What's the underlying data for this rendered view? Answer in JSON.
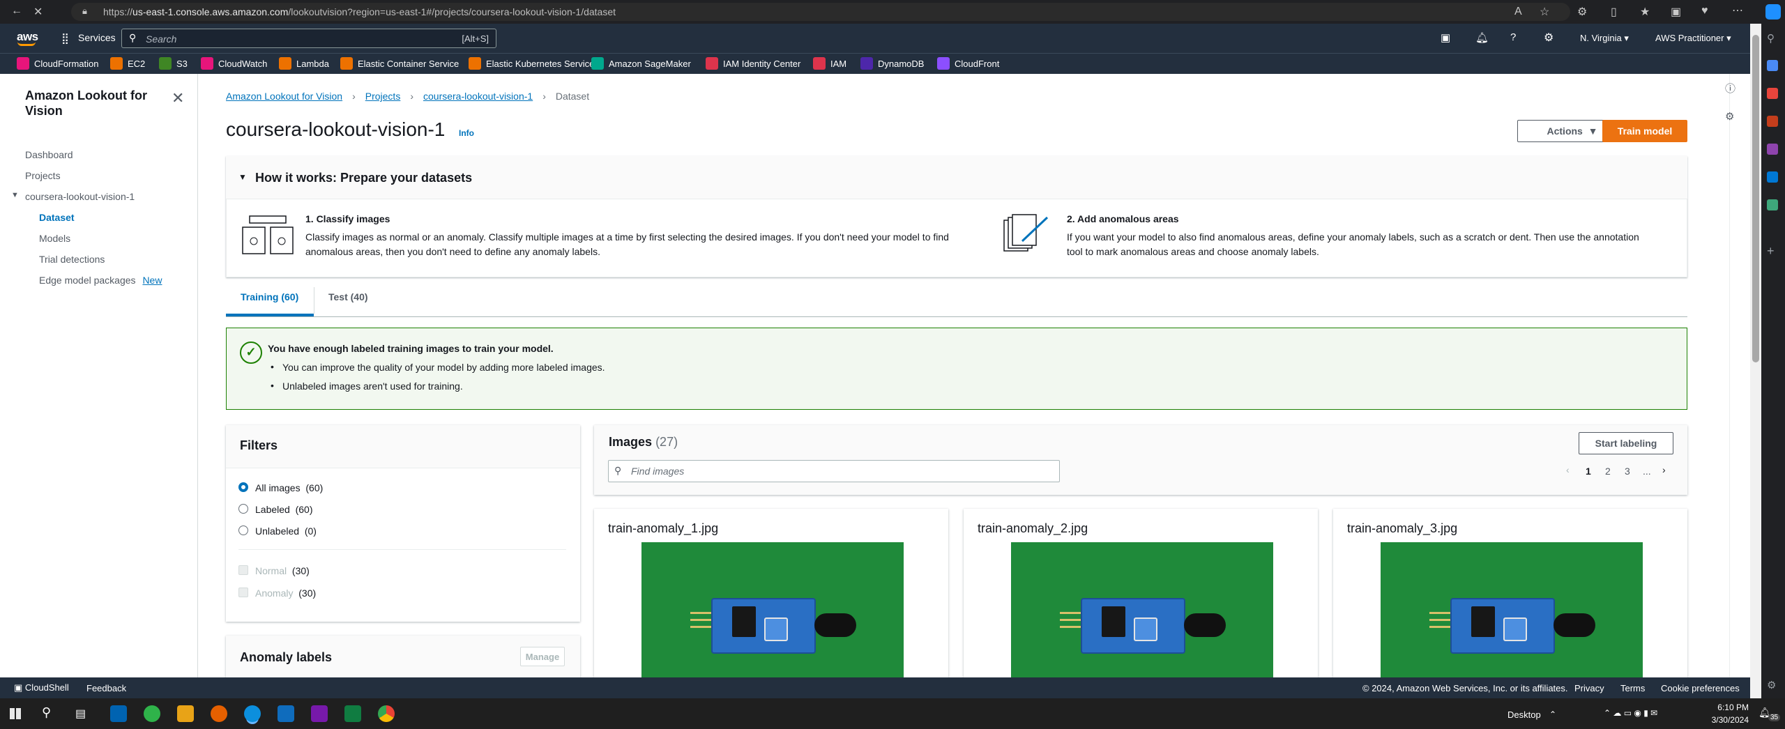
{
  "browser": {
    "url_prefix": "https://",
    "url_host": "us-east-1.console.aws.amazon.com",
    "url_path": "/lookoutvision?region=us-east-1#/projects/coursera-lookout-vision-1/dataset"
  },
  "aws_header": {
    "logo": "aws",
    "services_label": "Services",
    "search_placeholder": "Search",
    "search_shortcut": "[Alt+S]",
    "region": "N. Virginia",
    "account": "AWS Practitioner"
  },
  "favorites": [
    {
      "label": "CloudFormation",
      "color": "#e7157b"
    },
    {
      "label": "EC2",
      "color": "#ed7100"
    },
    {
      "label": "S3",
      "color": "#3f8624"
    },
    {
      "label": "CloudWatch",
      "color": "#e7157b"
    },
    {
      "label": "Lambda",
      "color": "#ed7100"
    },
    {
      "label": "Elastic Container Service",
      "color": "#ed7100"
    },
    {
      "label": "Elastic Kubernetes Service",
      "color": "#ed7100"
    },
    {
      "label": "Amazon SageMaker",
      "color": "#01a88d"
    },
    {
      "label": "IAM Identity Center",
      "color": "#dd344c"
    },
    {
      "label": "IAM",
      "color": "#dd344c"
    },
    {
      "label": "DynamoDB",
      "color": "#4d27aa"
    },
    {
      "label": "CloudFront",
      "color": "#8c4fff"
    }
  ],
  "sidebar": {
    "title": "Amazon Lookout for Vision",
    "items": {
      "dashboard": "Dashboard",
      "projects": "Projects",
      "project": "coursera-lookout-vision-1",
      "dataset": "Dataset",
      "models": "Models",
      "trial": "Trial detections",
      "edge": "Edge model packages",
      "edge_badge": "New"
    }
  },
  "breadcrumb": {
    "root": "Amazon Lookout for Vision",
    "projects": "Projects",
    "project": "coursera-lookout-vision-1",
    "current": "Dataset"
  },
  "page": {
    "title": "coursera-lookout-vision-1",
    "info": "Info",
    "actions_label": "Actions",
    "train_label": "Train model"
  },
  "how_it_works": {
    "title": "How it works: Prepare your datasets",
    "step1_title": "1. Classify images",
    "step1_desc_a": "Classify images as normal or an anomaly. Classify multiple images at a time by first selecting the desired images. If you don't need your model to find",
    "step1_desc_b": "anomalous areas, then you don't need to define any anomaly labels.",
    "step2_title": "2. Add anomalous areas",
    "step2_desc_a": "If you want your model to also find anomalous areas, define your anomaly labels, such as a scratch or dent. Then use the annotation",
    "step2_desc_b": "tool to mark anomalous areas and choose anomaly labels."
  },
  "tabs": {
    "training": "Training (60)",
    "test": "Test (40)"
  },
  "alert": {
    "title": "You have enough labeled training images to train your model.",
    "item1": "You can improve the quality of your model by adding more labeled images.",
    "item2": "Unlabeled images aren't used for training."
  },
  "filters": {
    "title": "Filters",
    "all": "All images",
    "all_count": "(60)",
    "labeled": "Labeled",
    "labeled_count": "(60)",
    "unlabeled": "Unlabeled",
    "unlabeled_count": "(0)",
    "normal": "Normal",
    "normal_count": "(30)",
    "anomaly": "Anomaly",
    "anomaly_count": "(30)"
  },
  "anomaly_labels": {
    "title": "Anomaly labels",
    "manage": "Manage"
  },
  "images": {
    "title": "Images",
    "count": "(27)",
    "start_labeling": "Start labeling",
    "find_placeholder": "Find images",
    "pages": [
      "1",
      "2",
      "3",
      "..."
    ],
    "cards": [
      {
        "name": "train-anomaly_1.jpg"
      },
      {
        "name": "train-anomaly_2.jpg"
      },
      {
        "name": "train-anomaly_3.jpg"
      }
    ]
  },
  "footer": {
    "cloudshell": "CloudShell",
    "feedback": "Feedback",
    "copyright": "© 2024, Amazon Web Services, Inc. or its affiliates.",
    "privacy": "Privacy",
    "terms": "Terms",
    "cookies": "Cookie preferences"
  },
  "taskbar": {
    "desktop": "Desktop",
    "time": "6:10 PM",
    "date": "3/30/2024",
    "badge": "35"
  }
}
